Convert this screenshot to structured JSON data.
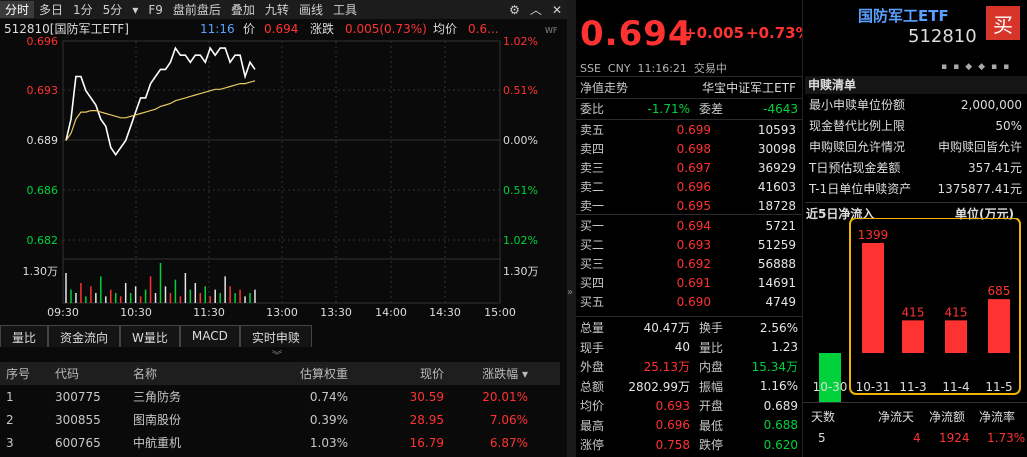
{
  "toolbar": {
    "tabs": [
      "分时",
      "多日",
      "1分",
      "5分",
      "▾",
      "F9",
      "盘前盘后",
      "叠加",
      "九转",
      "画线",
      "工具"
    ],
    "active": 0,
    "icons": [
      "gear-icon",
      "chevron-up-icon",
      "close-icon"
    ]
  },
  "chart": {
    "symbol": "512810[国防军工ETF]",
    "time": "11:16",
    "price_label": "价",
    "price": "0.694",
    "chg_label": "涨跌",
    "chg": "0.005(0.73%)",
    "avg_label": "均价",
    "avg": "0.6...",
    "wf": "WF",
    "y_left": [
      "0.696",
      "0.693",
      "0.689",
      "0.686",
      "0.682",
      "1.30万"
    ],
    "y_right": [
      "1.02%",
      "0.51%",
      "0.00%",
      "0.51%",
      "1.02%",
      "1.30万"
    ],
    "x_labels": [
      "09:30",
      "10:30",
      "11:30",
      "13:00",
      "13:30",
      "14:00",
      "14:30",
      "15:00"
    ],
    "colors": {
      "up": "#ff3232",
      "down": "#00d23c",
      "avg": "#e8c860",
      "line": "#ffffff"
    }
  },
  "chart_data": {
    "type": "line",
    "title": "512810[国防军工ETF]",
    "x_range": [
      "09:30",
      "15:00"
    ],
    "ylim": [
      0.682,
      0.696
    ],
    "prev_close": 0.689,
    "series": [
      {
        "name": "价",
        "values": [
          0.689,
          0.6905,
          0.6935,
          0.6935,
          0.6925,
          0.692,
          0.6915,
          0.6905,
          0.69,
          0.6885,
          0.688,
          0.6885,
          0.689,
          0.69,
          0.691,
          0.692,
          0.692,
          0.693,
          0.6935,
          0.694,
          0.694,
          0.6945,
          0.6955,
          0.695,
          0.695,
          0.6945,
          0.695,
          0.695,
          0.6945,
          0.6955,
          0.695,
          0.6955,
          0.6955,
          0.6945,
          0.695,
          0.695,
          0.6935,
          0.6945,
          0.694
        ]
      },
      {
        "name": "均价",
        "values": [
          0.689,
          0.6895,
          0.6905,
          0.691,
          0.691,
          0.6911,
          0.6911,
          0.691,
          0.6909,
          0.6908,
          0.6907,
          0.6906,
          0.6906,
          0.6907,
          0.6908,
          0.6909,
          0.691,
          0.6911,
          0.6912,
          0.6914,
          0.6915,
          0.6916,
          0.6918,
          0.6919,
          0.692,
          0.6921,
          0.6922,
          0.6923,
          0.6924,
          0.6925,
          0.6926,
          0.6926,
          0.6927,
          0.6928,
          0.6929,
          0.693,
          0.693,
          0.6931,
          0.6932
        ]
      }
    ],
    "volume": [
      9,
      4,
      3,
      6,
      2,
      5,
      3,
      8,
      2,
      4,
      3,
      2,
      6,
      3,
      5,
      2,
      4,
      8,
      3,
      12,
      5,
      3,
      7,
      2,
      9,
      4,
      6,
      3,
      5,
      2,
      4,
      3,
      8,
      5,
      3,
      4,
      2,
      3,
      4
    ]
  },
  "subtabs": [
    "量比",
    "资金流向",
    "W量比",
    "MACD",
    "实时申赎"
  ],
  "table": {
    "headers": [
      "序号",
      "代码",
      "名称",
      "估算权重",
      "现价",
      "涨跌幅 ▾"
    ],
    "rows": [
      [
        "1",
        "300775",
        "三角防务",
        "0.74%",
        "30.59",
        "20.01%"
      ],
      [
        "2",
        "300855",
        "图南股份",
        "0.39%",
        "28.95",
        "7.06%"
      ],
      [
        "3",
        "600765",
        "中航重机",
        "1.03%",
        "16.79",
        "6.87%"
      ]
    ]
  },
  "quote": {
    "price": "0.694",
    "chg": "+0.005",
    "pct": "+0.73%",
    "market": "SSE  CNY  11:16:21  交易中",
    "nav_label": "净值走势",
    "index": "华宝中证军工ETF",
    "wb_label": "委比",
    "wb": "-1.71%",
    "wc_label": "委差",
    "wc": "-4643",
    "asks": [
      [
        "卖五",
        "0.699",
        "10593"
      ],
      [
        "卖四",
        "0.698",
        "30098"
      ],
      [
        "卖三",
        "0.697",
        "36929"
      ],
      [
        "卖二",
        "0.696",
        "41603"
      ],
      [
        "卖一",
        "0.695",
        "18728"
      ]
    ],
    "bids": [
      [
        "买一",
        "0.694",
        "5721"
      ],
      [
        "买二",
        "0.693",
        "51259"
      ],
      [
        "买三",
        "0.692",
        "56888"
      ],
      [
        "买四",
        "0.691",
        "14691"
      ],
      [
        "买五",
        "0.690",
        "4749"
      ]
    ],
    "stats": [
      [
        "总量",
        "40.47万",
        "换手",
        "2.56%"
      ],
      [
        "现手",
        "40",
        "量比",
        "1.23"
      ],
      [
        "外盘",
        "25.13万",
        "内盘",
        "15.34万"
      ],
      [
        "总额",
        "2802.99万",
        "振幅",
        "1.16%"
      ],
      [
        "均价",
        "0.693",
        "开盘",
        "0.689"
      ],
      [
        "最高",
        "0.696",
        "最低",
        "0.688"
      ],
      [
        "涨停",
        "0.758",
        "跌停",
        "0.620"
      ]
    ]
  },
  "info": {
    "name": "国防军工ETF",
    "code": "512810",
    "buy_btn": "买",
    "section": "申赎清单",
    "items": [
      [
        "最小申赎单位份额",
        "2,000,000"
      ],
      [
        "现金替代比例上限",
        "50%"
      ],
      [
        "申购赎回允许情况",
        "申购赎回皆允许"
      ],
      [
        "T日预估现金差额",
        "357.41元"
      ],
      [
        "T-1日单位申赎资产",
        "1375877.41元"
      ]
    ],
    "flow_title": "近5日净流入",
    "flow_unit": "单位(万元)",
    "flow_footer_labels": [
      "天数",
      "净流天",
      "净流额",
      "净流率"
    ],
    "flow_footer_values": [
      "5",
      "4",
      "1924",
      "1.73%"
    ]
  },
  "flow_chart": {
    "type": "bar",
    "categories": [
      "10-30",
      "10-31",
      "11-3",
      "11-4",
      "11-5"
    ],
    "values": [
      -990,
      1399,
      415,
      415,
      685
    ],
    "ylim": [
      -1100,
      1500
    ]
  }
}
